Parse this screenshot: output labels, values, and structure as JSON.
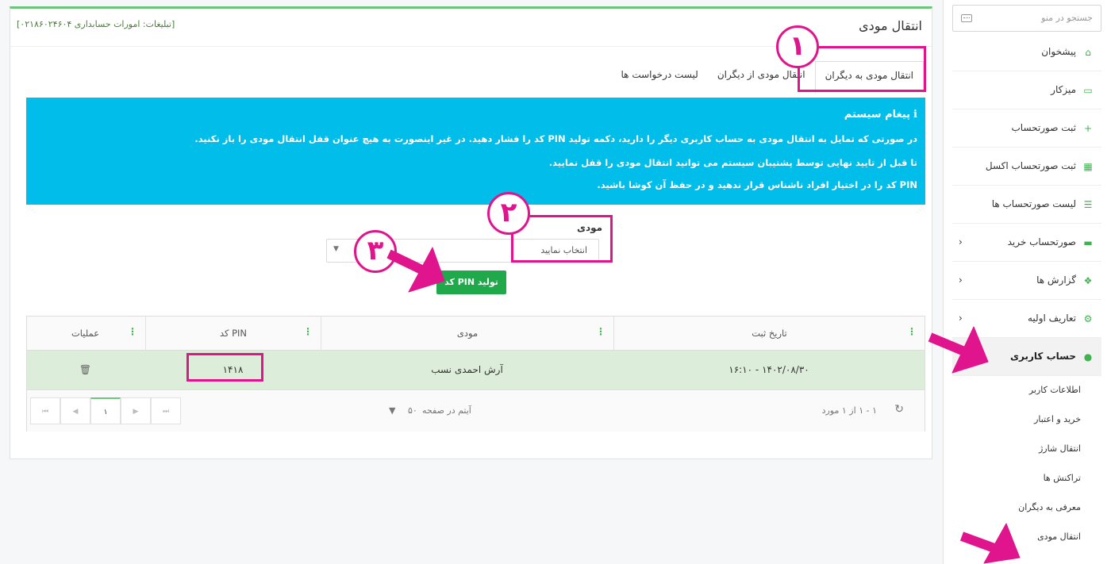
{
  "sidebar": {
    "search_placeholder": "جستجو در منو",
    "items": [
      {
        "label": "پیشخوان",
        "icon": "home-icon"
      },
      {
        "label": "میزکار",
        "icon": "monitor-icon"
      },
      {
        "label": "ثبت صورتحساب",
        "icon": "plus-icon"
      },
      {
        "label": "ثبت صورتحساب اکسل",
        "icon": "excel-icon"
      },
      {
        "label": "لیست صورتحساب ها",
        "icon": "list-icon"
      },
      {
        "label": "صورتحساب خرید",
        "icon": "money-icon"
      },
      {
        "label": "گزارش ها",
        "icon": "cubes-icon"
      },
      {
        "label": "تعاریف اولیه",
        "icon": "cogs-icon"
      },
      {
        "label": "حساب کاربری",
        "icon": "user-icon"
      }
    ],
    "sub_items": [
      "اطلاعات کاربر",
      "خرید و اعتبار",
      "انتقال شارژ",
      "تراکنش ها",
      "معرفی به دیگران",
      "انتقال مودی"
    ]
  },
  "header": {
    "title": "انتقال مودی",
    "ad": "[تبلیغات: امورات حسابداری ۰۲۱۸۶۰۲۴۶۰۴]"
  },
  "tabs": [
    "انتقال مودی به دیگران",
    "انتقال مودی از دیگران",
    "لیست درخواست ها"
  ],
  "alert": {
    "title": "پیغام سیستم",
    "lines": [
      "در صورتی که تمایل به انتقال مودی به حساب کاربری دیگر را دارید، دکمه تولید PIN کد را فشار دهید. در غیر اینصورت به هیچ عنوان قفل انتقال مودی را باز نکنید.",
      "تا قبل از تایید نهایی توسط پشتیبان سیستم می توانید انتقال مودی را قفل نمایید.",
      "PIN کد را در اختیار افراد ناشناس قرار ندهید و در حفظ آن کوشا باشید."
    ]
  },
  "form": {
    "label": "مودی",
    "select_value": "انتخاب نمایید",
    "button": "تولید PIN کد"
  },
  "grid": {
    "headers": [
      "تاریخ ثبت",
      "مودی",
      "PIN کد",
      "عملیات"
    ],
    "row": {
      "date": "۱۴۰۲/۰۸/۳۰ - ۱۶:۱۰",
      "name": "آرش احمدی نسب",
      "pin": "۱۴۱۸"
    },
    "pager": {
      "info": "۱ - ۱ از ۱ مورد",
      "per_page": "۵۰",
      "per_page_label": "آیتم در صفحه",
      "current": "۱"
    }
  },
  "annotations": [
    "۱",
    "۲",
    "۳"
  ],
  "colors": {
    "accent": "#3fb34f",
    "alert": "#00bdea",
    "highlight": "#e0148c",
    "row": "#dceed9",
    "button": "#1fa94b"
  }
}
